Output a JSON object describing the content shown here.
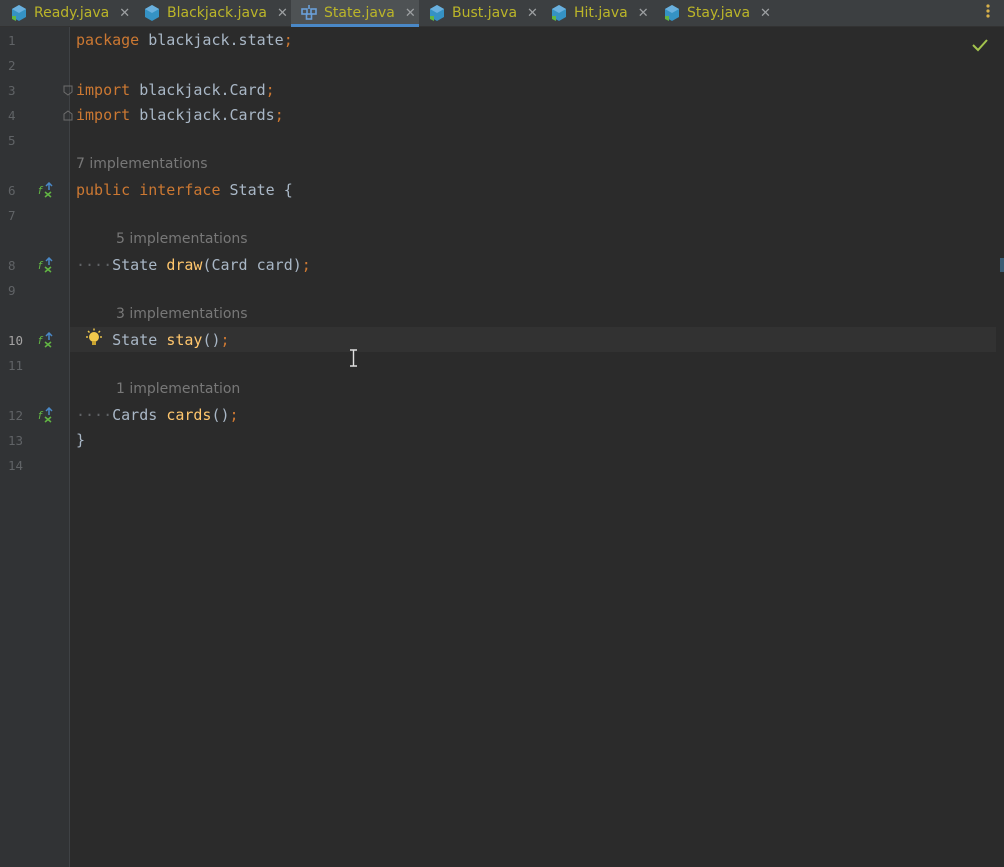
{
  "tabs": [
    {
      "label": "Ready.java",
      "icon": "java-class-icon"
    },
    {
      "label": "Blackjack.java",
      "icon": "java-class-icon"
    },
    {
      "label": "State.java",
      "icon": "java-interface-icon",
      "active": true
    },
    {
      "label": "Bust.java",
      "icon": "java-class-icon"
    },
    {
      "label": "Hit.java",
      "icon": "java-class-icon"
    },
    {
      "label": "Stay.java",
      "icon": "java-class-icon"
    }
  ],
  "tab_close_glyph": "✕",
  "menu_glyph": "⋮",
  "editor": {
    "line_numbers": [
      "1",
      "2",
      "3",
      "4",
      "5",
      "6",
      "7",
      "8",
      "9",
      "10",
      "11",
      "12",
      "13",
      "14"
    ],
    "current_line": "10",
    "code": {
      "l1_kw": "package",
      "l1_rest": "blackjack.state",
      "l1_semi": ";",
      "l3_kw": "import",
      "l3_rest": "blackjack.Card",
      "l3_semi": ";",
      "l4_kw": "import",
      "l4_rest": "blackjack.Cards",
      "l4_semi": ";",
      "l6_kw1": "public",
      "l6_kw2": "interface",
      "l6_rest": "State {",
      "l8_type": "State",
      "l8_fn": "draw",
      "l8_args": "(Card card)",
      "l8_semi": ";",
      "l10_type": "State",
      "l10_fn": "stay",
      "l10_args": "()",
      "l10_semi": ";",
      "l12_type": "Cards",
      "l12_fn": "cards",
      "l12_args": "()",
      "l12_semi": ";",
      "l13": "}"
    },
    "hints": {
      "interface": "7 implementations",
      "draw": "5 implementations",
      "stay": "3 implementations",
      "cards": "1 implementation"
    }
  },
  "colors": {
    "keyword": "#cc7832",
    "function": "#ffc66d",
    "text": "#a9b7c6",
    "tab_text": "#bbb529",
    "background": "#2b2b2b"
  }
}
